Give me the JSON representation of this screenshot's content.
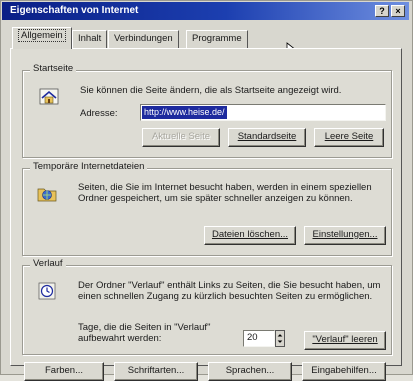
{
  "window": {
    "title": "Eigenschaften von Internet",
    "help_button": "?",
    "close_button": "×"
  },
  "tabs": [
    {
      "label": "Allgemein"
    },
    {
      "label": "Inhalt"
    },
    {
      "label": "Verbindungen"
    },
    {
      "label": "Programme"
    }
  ],
  "startseite": {
    "label": "Startseite",
    "description": "Sie können die Seite ändern, die als Startseite angezeigt wird.",
    "address_label": "Adresse:",
    "address_value": "http://www.heise.de/",
    "buttons": {
      "current": "Aktuelle Seite",
      "default": "Standardseite",
      "blank": "Leere Seite"
    }
  },
  "temp_files": {
    "label": "Temporäre Internetdateien",
    "description": "Seiten, die Sie im Internet besucht haben, werden in einem speziellen Ordner gespeichert, um sie später schneller anzeigen zu können.",
    "buttons": {
      "delete": "Dateien löschen...",
      "settings": "Einstellungen..."
    }
  },
  "history": {
    "label": "Verlauf",
    "description": "Der Ordner \"Verlauf\" enthält Links zu Seiten, die Sie besucht haben, um einen schnellen Zugang zu kürzlich besuchten Seiten zu ermöglichen.",
    "days_label": "Tage, die die Seiten in \"Verlauf\" aufbewahrt werden:",
    "days_value": "20",
    "clear_button": "\"Verlauf\" leeren"
  },
  "bottom_buttons": [
    "Farben...",
    "Schriftarten...",
    "Sprachen...",
    "Eingabehilfen..."
  ],
  "icons": {
    "home": "house-icon",
    "temp": "folder-globe-icon",
    "history": "history-icon",
    "cursor": "mouse-cursor-icon"
  }
}
